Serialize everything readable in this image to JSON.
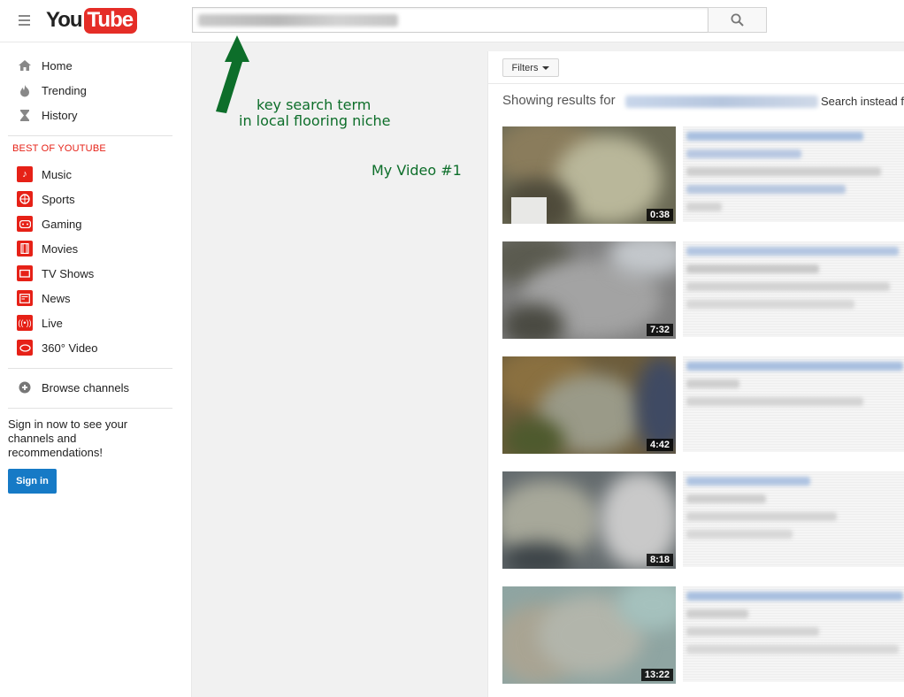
{
  "header": {
    "logo_you": "You",
    "logo_tube": "Tube",
    "search_value": "",
    "search_button_icon": "search-icon"
  },
  "sidebar": {
    "primary": [
      {
        "label": "Home",
        "icon": "home-icon"
      },
      {
        "label": "Trending",
        "icon": "flame-icon"
      },
      {
        "label": "History",
        "icon": "hourglass-icon"
      }
    ],
    "section_title": "BEST OF YOUTUBE",
    "best_of": [
      {
        "label": "Music",
        "icon": "music-note-icon"
      },
      {
        "label": "Sports",
        "icon": "ball-icon"
      },
      {
        "label": "Gaming",
        "icon": "gamepad-icon"
      },
      {
        "label": "Movies",
        "icon": "film-strip-icon"
      },
      {
        "label": "TV Shows",
        "icon": "tv-icon"
      },
      {
        "label": "News",
        "icon": "newspaper-icon"
      },
      {
        "label": "Live",
        "icon": "broadcast-icon"
      },
      {
        "label": "360° Video",
        "icon": "360-icon"
      }
    ],
    "browse": {
      "label": "Browse channels",
      "icon": "plus-circle-icon"
    },
    "signin_text": "Sign in now to see your channels and recommendations!",
    "signin_button": "Sign in"
  },
  "annotation": {
    "line1": "key search term",
    "line2": "in local flooring niche",
    "video_label": "My Video #1",
    "color": "#0d6e2a"
  },
  "results": {
    "filters_label": "Filters",
    "showing_prefix": "Showing results for",
    "search_instead": "Search instead f",
    "videos": [
      {
        "duration": "0:38"
      },
      {
        "duration": "7:32"
      },
      {
        "duration": "4:42"
      },
      {
        "duration": "8:18"
      },
      {
        "duration": "13:22"
      }
    ]
  },
  "colors": {
    "brand_red": "#e52d27",
    "signin_blue": "#167ac6",
    "section_red": "#e62117"
  }
}
